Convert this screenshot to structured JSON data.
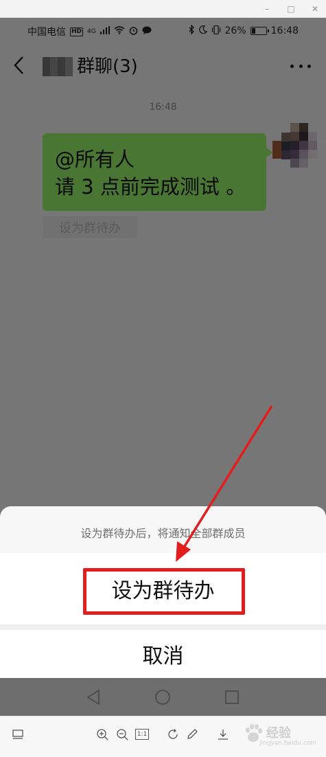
{
  "window": {
    "minimize_glyph": "–",
    "maximize_glyph": "□",
    "close_glyph": "✕"
  },
  "status_bar": {
    "carrier": "中国电信",
    "hd_badge": "HD",
    "network_type": "4G",
    "battery_percent": "26%",
    "time": "16:48",
    "battery_level": 0.26
  },
  "chat": {
    "title": "群聊(3)",
    "timestamp": "16:48",
    "message_lines": [
      "@所有人",
      "请 3 点前完成测试 。"
    ],
    "set_todo_chip": "设为群待办"
  },
  "action_sheet": {
    "hint": "设为群待办后，将通知全部群成员",
    "primary_action": "设为群待办",
    "cancel": "取消"
  },
  "viewer_toolbar": {
    "actual_size_label": "1:1"
  },
  "watermark": {
    "main": "经验",
    "sub": "jingyan.baidu.com"
  },
  "colors": {
    "bubble": "#95ec69",
    "annotation": "#e31c1c",
    "nav_bar": "#6e6e6e"
  }
}
